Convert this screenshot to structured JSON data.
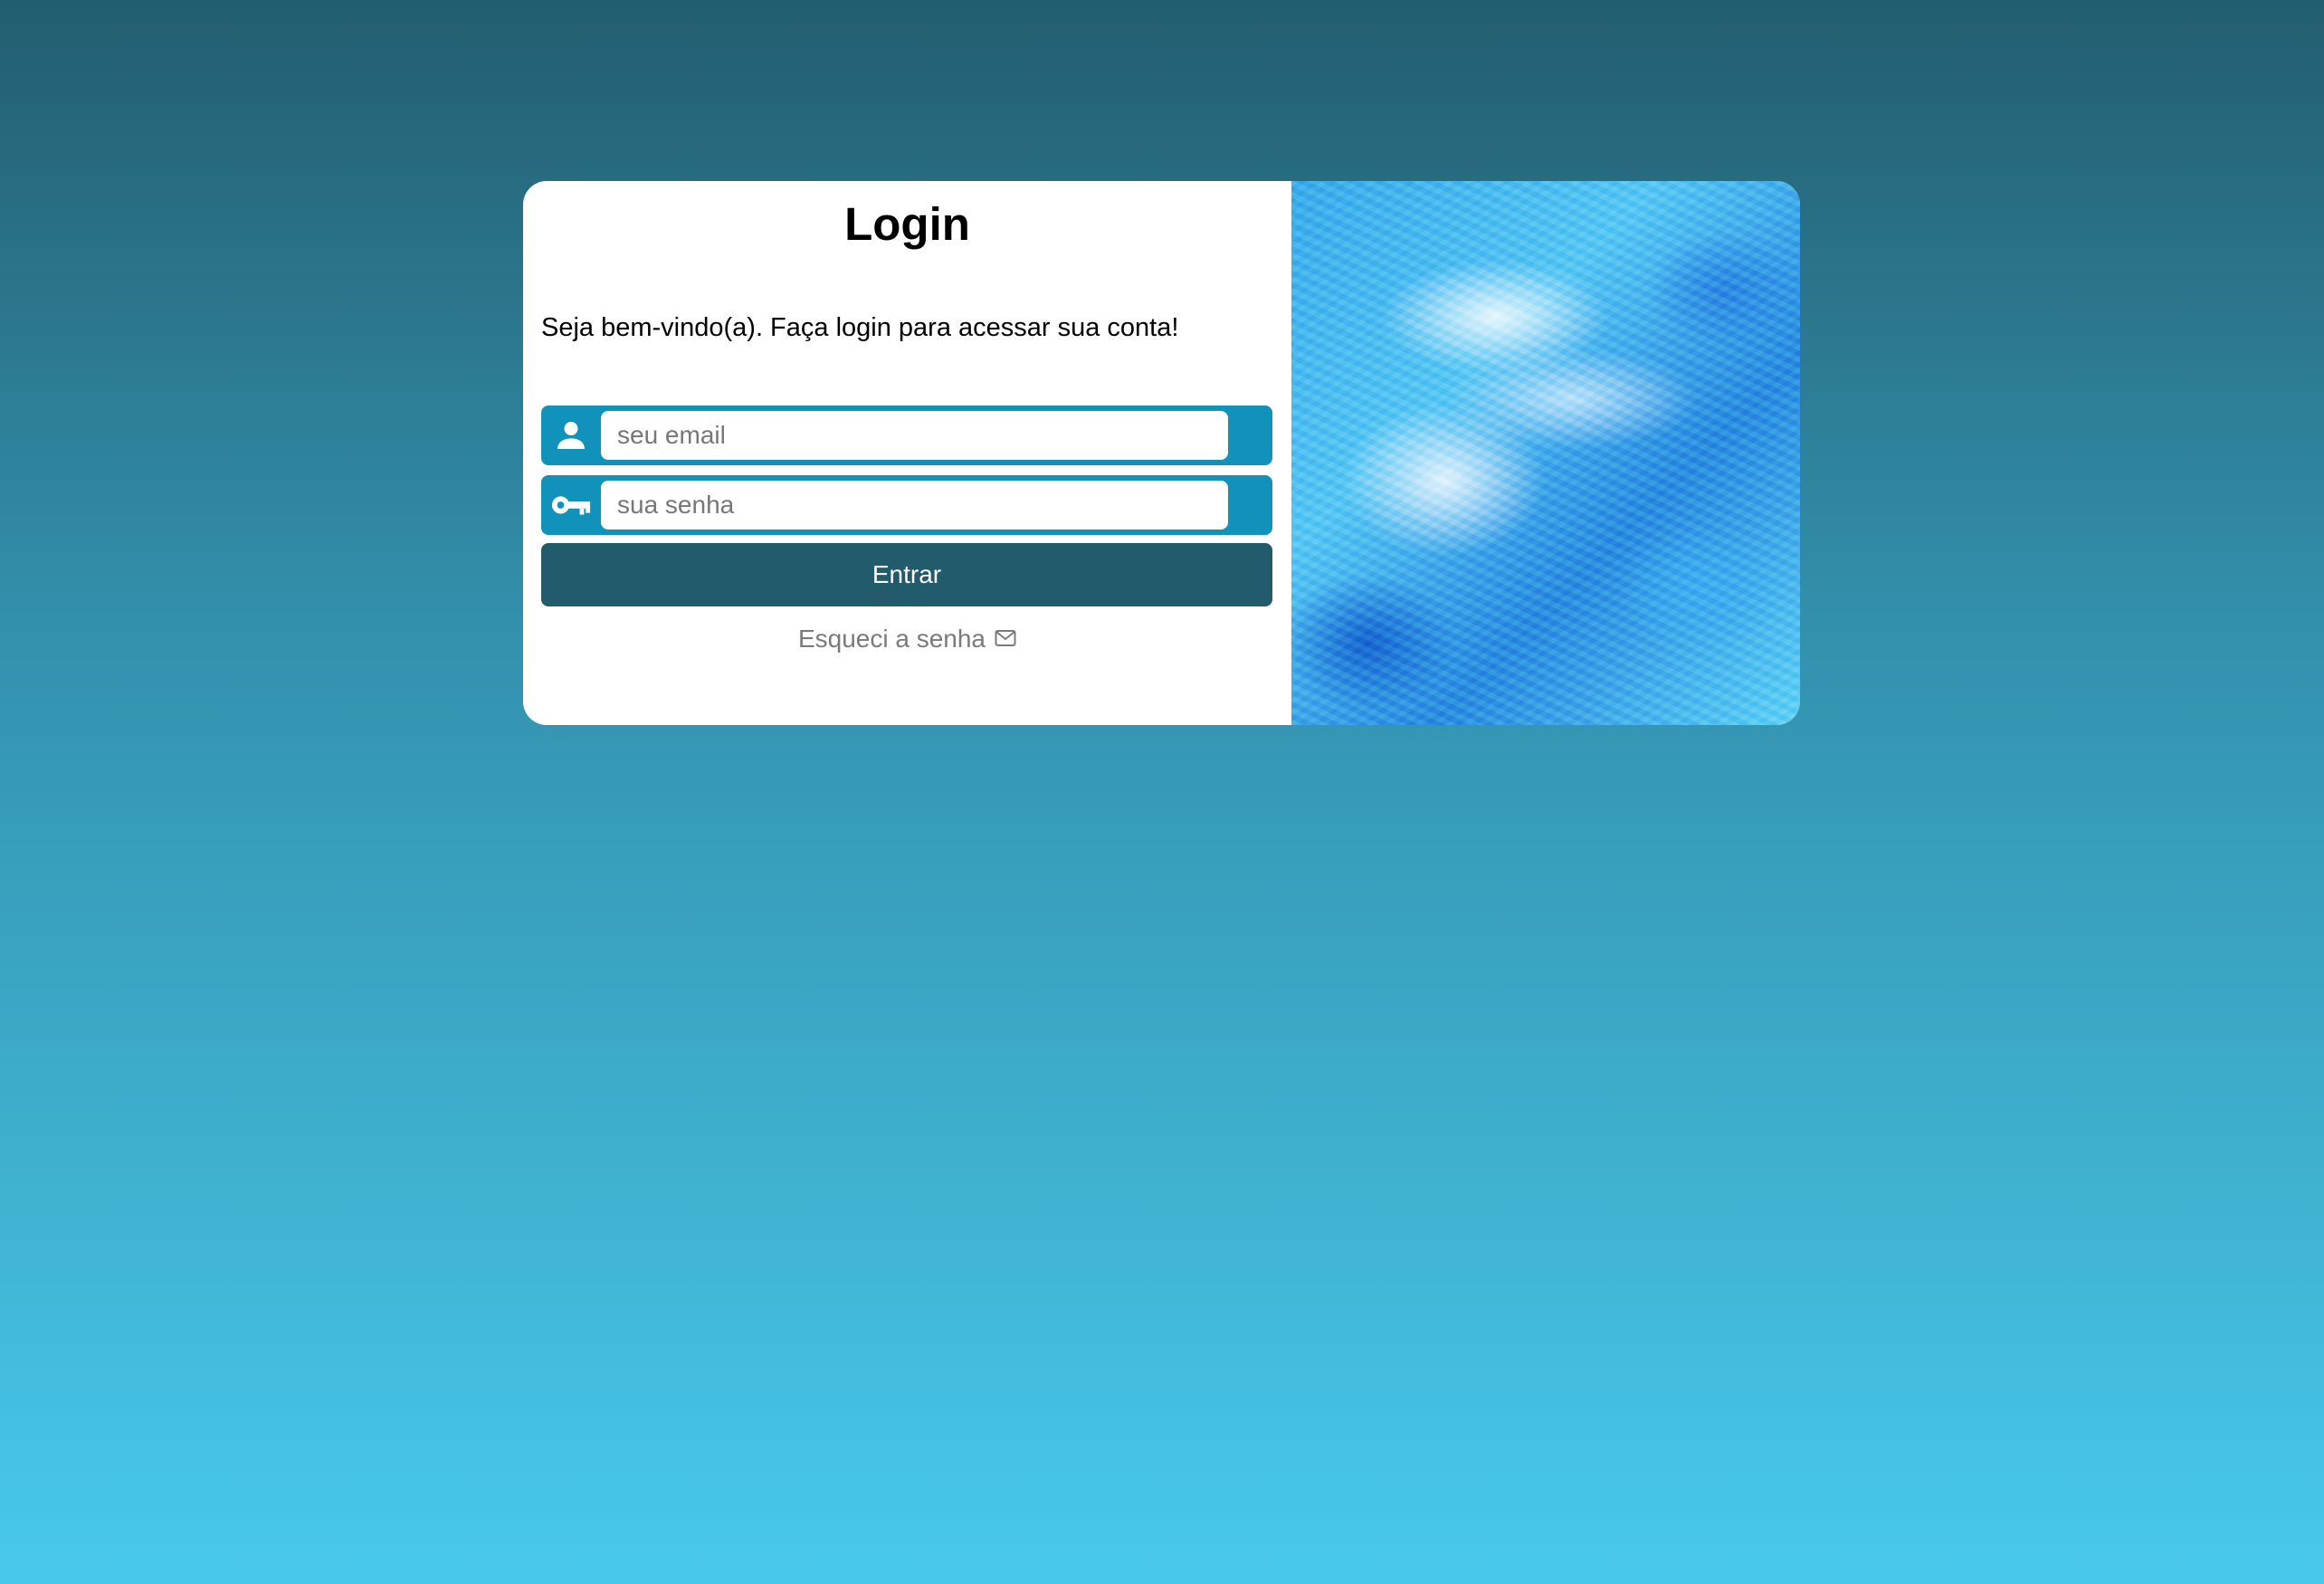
{
  "login": {
    "title": "Login",
    "welcome": "Seja bem-vindo(a). Faça login para acessar sua conta!",
    "email": {
      "placeholder": "seu email",
      "value": "",
      "icon": "user-icon"
    },
    "password": {
      "placeholder": "sua senha",
      "value": "",
      "icon": "key-icon"
    },
    "submit_label": "Entrar",
    "forgot_label": "Esqueci a senha",
    "forgot_icon": "mail-icon"
  },
  "colors": {
    "field_bar": "#1192bb",
    "button": "#225b6c",
    "background_top": "#235d6f",
    "background_bottom": "#48c9ec"
  }
}
